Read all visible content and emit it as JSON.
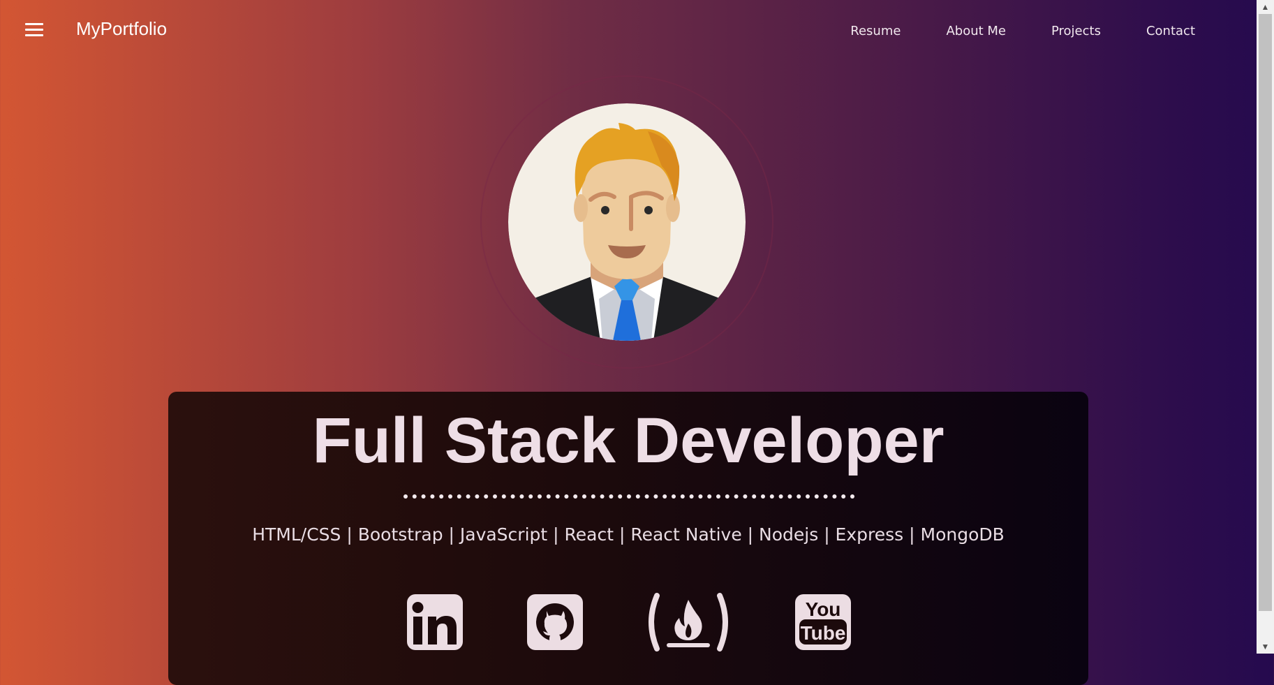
{
  "header": {
    "brand": "MyPortfolio",
    "nav": [
      "Resume",
      "About Me",
      "Projects",
      "Contact"
    ]
  },
  "hero": {
    "title": "Full Stack Developer",
    "skills": "HTML/CSS | Bootstrap | JavaScript | React | React Native | Nodejs | Express | MongoDB"
  },
  "socials": [
    "linkedin-icon",
    "github-icon",
    "freecodecamp-icon",
    "youtube-icon"
  ],
  "colors": {
    "gradient_left": "#d35633",
    "gradient_right": "#250a4e",
    "card_bg": "#1c0a0c",
    "text_light": "#eedee6",
    "icon_fill": "#ecdde3"
  }
}
